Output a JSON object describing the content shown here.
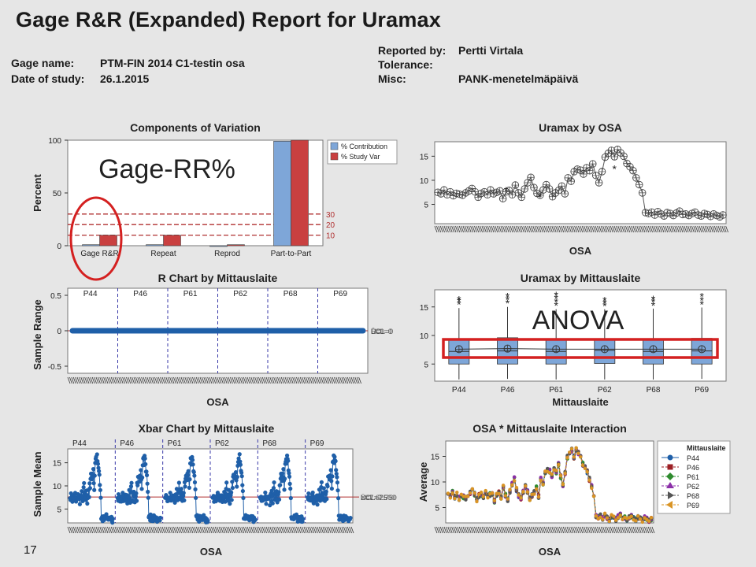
{
  "report": {
    "title": "Gage R&R (Expanded) Report for Uramax",
    "gage_name_label": "Gage name:",
    "gage_name": "PTM-FIN 2014 C1-testin osa",
    "date_label": "Date of study:",
    "date": "26.1.2015",
    "reported_by_label": "Reported by:",
    "reported_by": "Pertti Virtala",
    "tolerance_label": "Tolerance:",
    "tolerance": "",
    "misc_label": "Misc:",
    "misc": "PANK-menetelmäpäivä",
    "page_number": "17"
  },
  "annotations": {
    "gage_rr_label": "Gage-RR%",
    "anova_label": "ANOVA",
    "highlight_color": "#d42020"
  },
  "colors": {
    "contribution": "#7ea6d8",
    "study_var": "#c94040",
    "series_blue": "#1f5fa8",
    "limit_red": "#b03030"
  },
  "chart_data": [
    {
      "id": "components",
      "type": "bar",
      "title": "Components of Variation",
      "ylabel": "Percent",
      "ylim": [
        0,
        100
      ],
      "yticks": [
        0,
        50,
        100
      ],
      "categories": [
        "Gage R&R",
        "Repeat",
        "Reprod",
        "Part-to-Part"
      ],
      "series": [
        {
          "name": "% Contribution",
          "values": [
            1,
            1,
            0,
            99
          ]
        },
        {
          "name": "% Study Var",
          "values": [
            10,
            10,
            1,
            100
          ]
        }
      ],
      "reference_lines": [
        30,
        20,
        10
      ],
      "legend": "top-right"
    },
    {
      "id": "by_osa",
      "type": "line",
      "title": "Uramax by OSA",
      "xlabel": "OSA",
      "ylim": [
        1,
        18
      ],
      "yticks": [
        5,
        10,
        15
      ],
      "y": [
        7.5,
        7.2,
        8.0,
        7.0,
        7.6,
        6.8,
        7.3,
        7.1,
        6.9,
        7.4,
        7.8,
        8.3,
        7.6,
        6.5,
        7.3,
        7.6,
        7.0,
        8.0,
        7.2,
        7.5,
        7.8,
        6.2,
        7.6,
        7.9,
        7.0,
        9.0,
        7.4,
        6.5,
        8.2,
        9.5,
        10.6,
        8.5,
        7.3,
        6.9,
        8.0,
        9.1,
        8.2,
        6.6,
        7.4,
        7.9,
        8.8,
        7.2,
        10.5,
        9.8,
        11.8,
        12.3,
        12.1,
        11.3,
        12.6,
        12.0,
        13.4,
        11.0,
        9.5,
        11.8,
        14.8,
        15.6,
        16.2,
        14.9,
        16.4,
        15.7,
        15.0,
        13.5,
        12.8,
        12.0,
        10.5,
        9.1,
        7.4,
        3.3,
        3.1,
        3.4,
        2.8,
        3.5,
        3.0,
        2.6,
        3.3,
        3.1,
        2.7,
        3.2,
        3.6,
        2.9,
        3.0,
        2.7,
        3.1,
        3.4,
        2.8,
        2.6,
        3.1,
        2.9,
        2.5,
        3.0,
        2.7,
        2.4,
        2.8
      ],
      "outliers": [
        6.7,
        12.5,
        8.0
      ]
    },
    {
      "id": "r_chart",
      "type": "line",
      "title": "R Chart by Mittauslaite",
      "ylabel": "Sample Range",
      "xlabel": "OSA",
      "ylim": [
        -0.6,
        0.6
      ],
      "yticks": [
        -0.5,
        0.0,
        0.5
      ],
      "groups": [
        "P44",
        "P46",
        "P61",
        "P62",
        "P68",
        "P69"
      ],
      "value": 0,
      "limit_labels": [
        "UCL=0",
        "R̄=0",
        "LCL=0"
      ]
    },
    {
      "id": "boxplot",
      "type": "boxplot",
      "title": "Uramax by Mittauslaite",
      "xlabel": "Mittauslaite",
      "ylim": [
        2,
        18
      ],
      "yticks": [
        5,
        10,
        15
      ],
      "categories": [
        "P44",
        "P46",
        "P61",
        "P62",
        "P68",
        "P69"
      ],
      "boxes": [
        {
          "q1": 5.0,
          "median": 7.2,
          "mean": 7.6,
          "q3": 9.4,
          "low": 2.3,
          "high": 14.8,
          "outliers": [
            15.6,
            16.1,
            16.4
          ]
        },
        {
          "q1": 5.0,
          "median": 7.3,
          "mean": 7.7,
          "q3": 9.6,
          "low": 2.4,
          "high": 15.0,
          "outliers": [
            15.8,
            16.4,
            17.0
          ]
        },
        {
          "q1": 5.0,
          "median": 7.2,
          "mean": 7.6,
          "q3": 9.4,
          "low": 2.3,
          "high": 14.6,
          "outliers": [
            15.4,
            16.0,
            16.6,
            17.2
          ]
        },
        {
          "q1": 5.1,
          "median": 7.4,
          "mean": 7.6,
          "q3": 9.3,
          "low": 2.3,
          "high": 14.6,
          "outliers": [
            15.3,
            15.8,
            16.3
          ]
        },
        {
          "q1": 5.0,
          "median": 7.2,
          "mean": 7.6,
          "q3": 9.4,
          "low": 2.3,
          "high": 14.7,
          "outliers": [
            15.4,
            16.0,
            16.5
          ]
        },
        {
          "q1": 5.0,
          "median": 7.3,
          "mean": 7.6,
          "q3": 9.5,
          "low": 2.4,
          "high": 14.9,
          "outliers": [
            15.6,
            16.3,
            17.0
          ]
        }
      ]
    },
    {
      "id": "xbar_chart",
      "type": "line",
      "title": "Xbar Chart by Mittauslaite",
      "ylabel": "Sample Mean",
      "xlabel": "OSA",
      "ylim": [
        2,
        18
      ],
      "yticks": [
        5,
        10,
        15
      ],
      "groups": [
        "P44",
        "P46",
        "P61",
        "P62",
        "P68",
        "P69"
      ],
      "center": 7.6,
      "limit_labels": [
        "UCL=7.750",
        "X̄=7.625",
        "LCL=7.500"
      ]
    },
    {
      "id": "interaction",
      "type": "line",
      "title": "OSA * Mittauslaite Interaction",
      "ylabel": "Average",
      "xlabel": "OSA",
      "ylim": [
        2,
        18
      ],
      "yticks": [
        5,
        10,
        15
      ],
      "legend_title": "Mittauslaite",
      "series": [
        {
          "name": "P44",
          "color": "#1f5fa8",
          "marker": "circle"
        },
        {
          "name": "P46",
          "color": "#9c1f24",
          "marker": "square"
        },
        {
          "name": "P61",
          "color": "#2e8b2e",
          "marker": "diamond"
        },
        {
          "name": "P62",
          "color": "#8b2fa8",
          "marker": "triangle"
        },
        {
          "name": "P68",
          "color": "#555555",
          "marker": "triangle-right"
        },
        {
          "name": "P69",
          "color": "#d99425",
          "marker": "triangle-left"
        }
      ],
      "legend": "right"
    }
  ]
}
